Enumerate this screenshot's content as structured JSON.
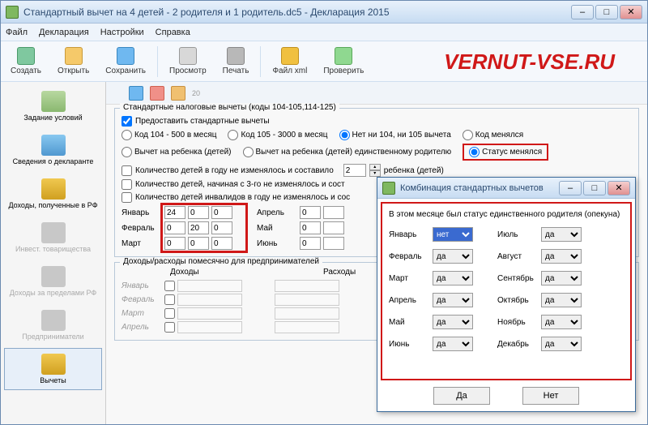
{
  "window": {
    "title": "Стандартный вычет на 4 детей - 2 родителя и 1 родитель.dc5 - Декларация 2015"
  },
  "menu": {
    "file": "Файл",
    "decl": "Декларация",
    "settings": "Настройки",
    "help": "Справка"
  },
  "toolbar": {
    "new": "Создать",
    "open": "Открыть",
    "save": "Сохранить",
    "view": "Просмотр",
    "print": "Печать",
    "xml": "Файл xml",
    "check": "Проверить"
  },
  "watermark": "VERNUT-VSE.RU",
  "sidebar": {
    "i1": "Задание условий",
    "i2": "Сведения о декларанте",
    "i3": "Доходы, полученные в РФ",
    "i4": "Инвест. товарищества",
    "i5": "Доходы за пределами РФ",
    "i6": "Предприниматели",
    "i7": "Вычеты"
  },
  "mini": {
    "lbl": "20"
  },
  "group1": {
    "title": "Стандартные налоговые вычеты (коды 104-105,114-125)",
    "chk1": "Предоставить стандартные вычеты",
    "r1": "Код 104 - 500 в месяц",
    "r2": "Код 105 - 3000 в месяц",
    "r3": "Нет ни 104, ни 105 вычета",
    "r4": "Код менялся",
    "r5": "Вычет на ребенка (детей)",
    "r6": "Вычет на ребенка (детей) единственному родителю",
    "r7": "Статус менялся",
    "chk2": "Количество детей в году не изменялось и составило",
    "chk3": "Количество детей, начиная с 3-го не изменялось и сост",
    "chk4": "Количество детей инвалидов в году не изменялось и сос",
    "spin_val": "2",
    "spin_lbl": "ребенка (детей)"
  },
  "months": {
    "m1": "Январь",
    "m2": "Февраль",
    "m3": "Март",
    "m4": "Апрель",
    "m5": "Май",
    "m6": "Июнь",
    "vals": {
      "m1a": "24",
      "m1b": "0",
      "m1c": "0",
      "m2a": "0",
      "m2b": "20",
      "m2c": "0",
      "m3a": "0",
      "m3b": "0",
      "m3c": "0",
      "m4a": "0",
      "m5a": "0",
      "m6a": "0"
    }
  },
  "entr": {
    "title": "Доходы/расходы помесячно для предпринимателей",
    "h1": "Доходы",
    "h2": "Расходы",
    "m1": "Январь",
    "m2": "Февраль",
    "m3": "Март",
    "m4": "Апрель"
  },
  "dialog": {
    "title": "Комбинация стандартных вычетов",
    "msg": "В этом месяце был статус единственного родителя (опекуна)",
    "m1": "Январь",
    "m2": "Февраль",
    "m3": "Март",
    "m4": "Апрель",
    "m5": "Май",
    "m6": "Июнь",
    "m7": "Июль",
    "m8": "Август",
    "m9": "Сентябрь",
    "m10": "Октябрь",
    "m11": "Ноябрь",
    "m12": "Декабрь",
    "v1": "нет",
    "v": "да",
    "yes": "Да",
    "no": "Нет"
  }
}
